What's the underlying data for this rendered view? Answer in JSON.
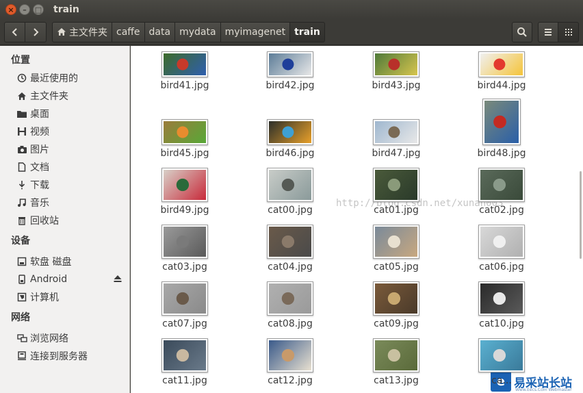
{
  "window": {
    "title": "train",
    "controls": {
      "close": "×",
      "minimize": "–",
      "maximize": "□"
    }
  },
  "toolbar": {
    "back_icon": "chevron-left-icon",
    "forward_icon": "chevron-right-icon",
    "breadcrumbs": [
      {
        "label": "主文件夹",
        "icon": "home-icon"
      },
      {
        "label": "caffe"
      },
      {
        "label": "data"
      },
      {
        "label": "mydata"
      },
      {
        "label": "myimagenet"
      },
      {
        "label": "train",
        "active": true
      }
    ],
    "search_icon": "search-icon",
    "list_view_icon": "list-view-icon",
    "grid_view_icon": "grid-view-icon"
  },
  "sidebar": {
    "sections": [
      {
        "title": "位置",
        "items": [
          {
            "label": "最近使用的",
            "icon": "clock-icon"
          },
          {
            "label": "主文件夹",
            "icon": "home-icon"
          },
          {
            "label": "桌面",
            "icon": "folder-icon"
          },
          {
            "label": "视频",
            "icon": "film-icon"
          },
          {
            "label": "图片",
            "icon": "camera-icon"
          },
          {
            "label": "文档",
            "icon": "document-icon"
          },
          {
            "label": "下载",
            "icon": "download-icon"
          },
          {
            "label": "音乐",
            "icon": "music-icon"
          },
          {
            "label": "回收站",
            "icon": "trash-icon"
          }
        ]
      },
      {
        "title": "设备",
        "items": [
          {
            "label": "软盘 磁盘",
            "icon": "floppy-icon"
          },
          {
            "label": "Android",
            "icon": "phone-icon",
            "eject": true
          },
          {
            "label": "计算机",
            "icon": "computer-icon"
          }
        ]
      },
      {
        "title": "网络",
        "items": [
          {
            "label": "浏览网络",
            "icon": "network-icon"
          },
          {
            "label": "连接到服务器",
            "icon": "server-icon"
          }
        ]
      }
    ]
  },
  "files": [
    "bird41.jpg",
    "bird42.jpg",
    "bird43.jpg",
    "bird44.jpg",
    "bird45.jpg",
    "bird46.jpg",
    "bird47.jpg",
    "bird48.jpg",
    "bird49.jpg",
    "cat00.jpg",
    "cat01.jpg",
    "cat02.jpg",
    "cat03.jpg",
    "cat04.jpg",
    "cat05.jpg",
    "cat06.jpg",
    "cat07.jpg",
    "cat08.jpg",
    "cat09.jpg",
    "cat10.jpg",
    "cat11.jpg",
    "cat12.jpg",
    "cat13.jpg",
    "ca..."
  ],
  "watermark": "http://blog.csdn.net/xunan003",
  "logo": {
    "mark": "e",
    "text": "易采站长站",
    "sub": "Www.Eecs.Com Webmaster"
  }
}
